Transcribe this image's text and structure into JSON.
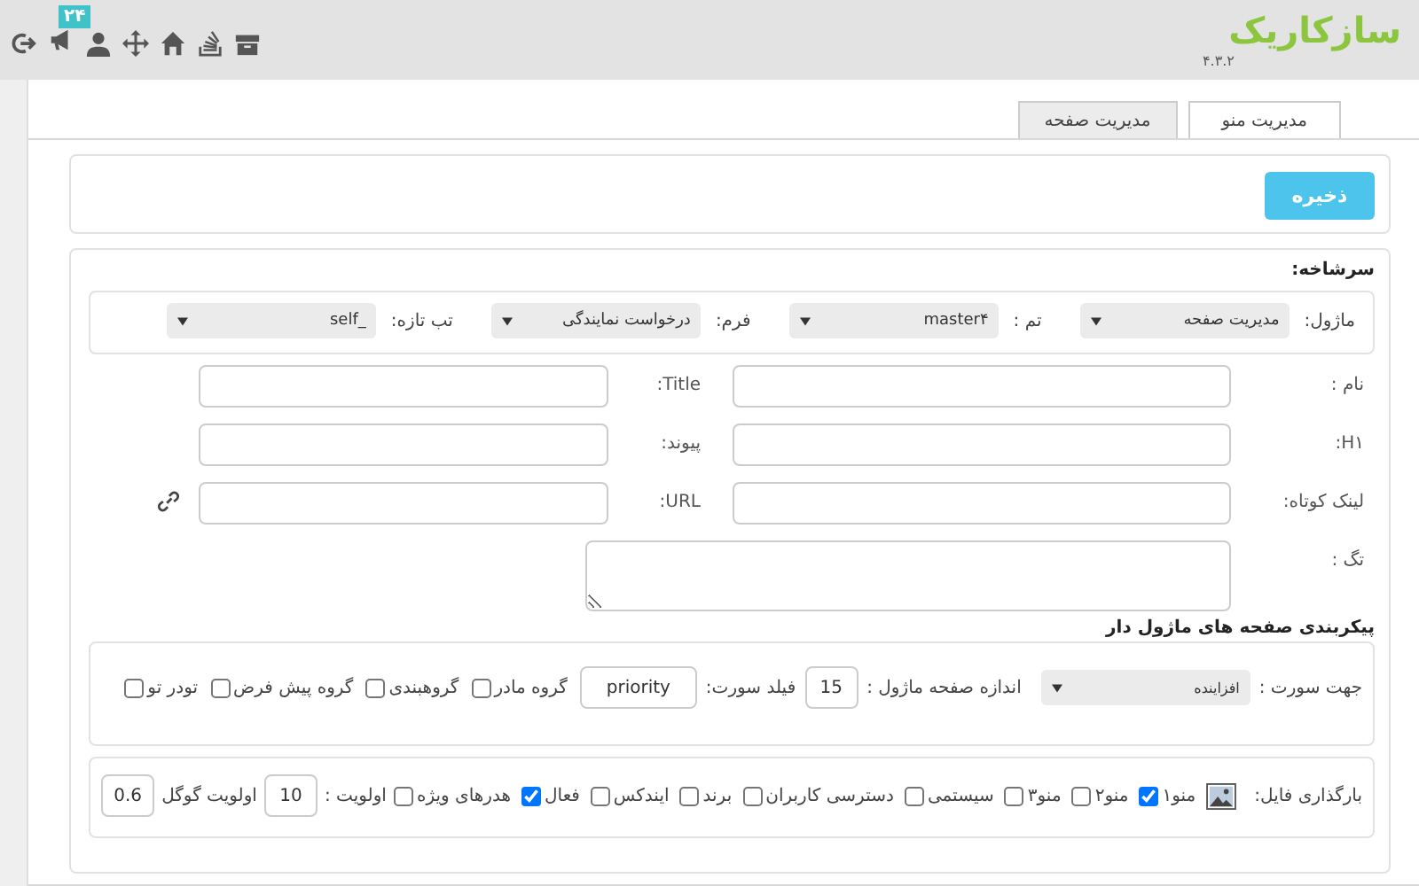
{
  "topbar": {
    "badge": "۲۴",
    "logo": "سازکاریک",
    "version": "۴.۳.۲"
  },
  "tabs": [
    {
      "label": "مدیریت منو",
      "selected": true
    },
    {
      "label": "مدیریت صفحه",
      "selected": false
    }
  ],
  "save_button": "ذخیره",
  "header": {
    "title": "سرشاخه:",
    "selects": [
      {
        "label": "ماژول:",
        "value": "مدیریت صفحه"
      },
      {
        "label": "تم :",
        "value": "master۴"
      },
      {
        "label": "فرم:",
        "value": "درخواست نمایندگی"
      },
      {
        "label": "تب تازه:",
        "value": "_self"
      }
    ]
  },
  "fields": [
    {
      "kind": "pair",
      "label": "نام :",
      "side_label": "Title:"
    },
    {
      "kind": "pair",
      "label": "H۱:",
      "side_label": "پیوند:"
    },
    {
      "kind": "pair_link",
      "label": "لینک کوتاه:",
      "side_label": "URL:"
    },
    {
      "kind": "textarea",
      "label": "تگ :"
    }
  ],
  "paging": {
    "title": "پیکربندی صفحه های ماژول دار",
    "sort_direction": {
      "label": "جهت سورت :",
      "value": "افزاینده"
    },
    "page_size": {
      "label": "اندازه صفحه ماژول :",
      "value": "15"
    },
    "sort_field": {
      "label": "فیلد سورت:",
      "value": "priority"
    },
    "checkboxes": [
      {
        "label": "گروه مادر",
        "checked": false
      },
      {
        "label": "گروهبندی",
        "checked": false
      },
      {
        "label": "گروه پیش فرض",
        "checked": false
      },
      {
        "label": "تودر تو",
        "checked": false
      }
    ]
  },
  "options": {
    "upload_label": "بارگذاری فایل:",
    "checkboxes": [
      {
        "label": "منو۱",
        "checked": true
      },
      {
        "label": "منو۲",
        "checked": false
      },
      {
        "label": "منو۳",
        "checked": false
      },
      {
        "label": "سیستمی",
        "checked": false
      },
      {
        "label": "دسترسی کاربران",
        "checked": false
      },
      {
        "label": "برند",
        "checked": false
      },
      {
        "label": "ایندکس",
        "checked": false
      },
      {
        "label": "فعال",
        "checked": true
      },
      {
        "label": "هدرهای ویژه",
        "checked": false
      }
    ],
    "priority": {
      "label": "اولویت :",
      "value": "10"
    },
    "google_priority": {
      "label": "اولویت گوگل",
      "value": "0.6"
    }
  }
}
